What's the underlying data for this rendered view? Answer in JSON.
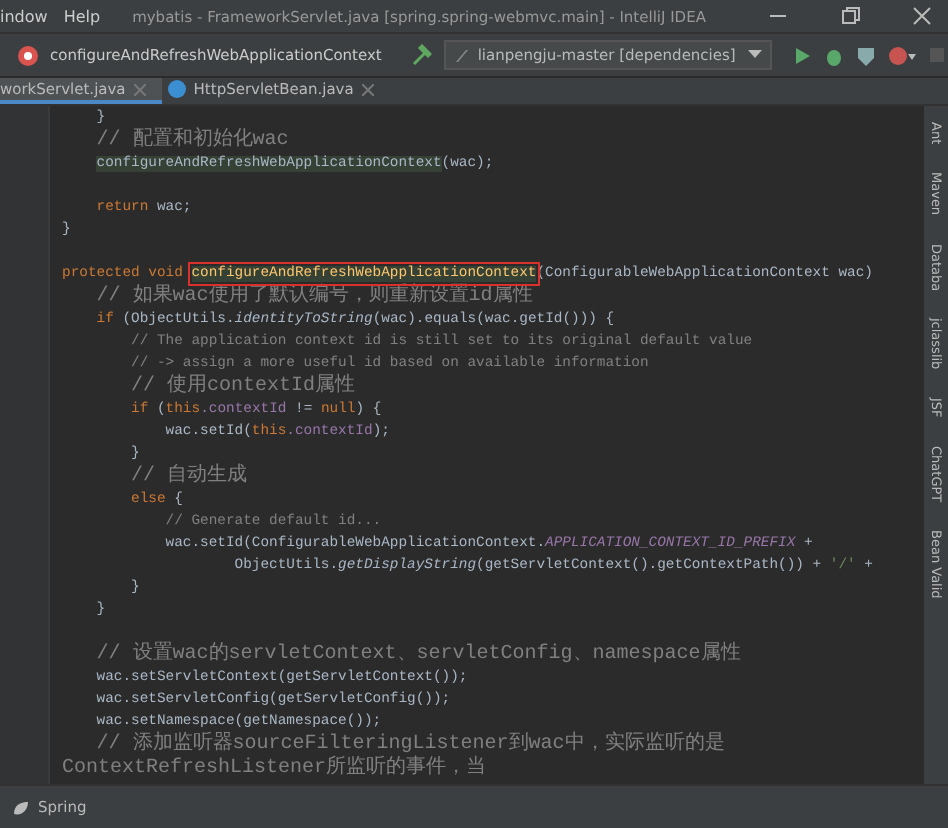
{
  "menu": {
    "items": [
      "indow",
      "Help"
    ],
    "title": "mybatis - FrameworkServlet.java [spring.spring-webmvc.main] - IntelliJ IDEA"
  },
  "toolbar": {
    "breadcrumb": "configureAndRefreshWebApplicationContext",
    "run_config": "lianpengju-master [dependencies]"
  },
  "tabs": [
    {
      "label": "workServlet.java",
      "selected": true
    },
    {
      "label": "HttpServletBean.java",
      "selected": false
    }
  ],
  "editor": {
    "lines": [
      {
        "kind": "code",
        "segments": [
          {
            "text": "    }",
            "kind": "plain"
          }
        ]
      },
      {
        "kind": "code",
        "segments": [
          {
            "text": "    // 配置和初始化wac",
            "kind": "comment"
          }
        ]
      },
      {
        "kind": "code",
        "segments": [
          {
            "text": "    configureAndRefreshWebApplicationContext",
            "kind": "usage"
          },
          {
            "text": "(wac);",
            "kind": "plain"
          }
        ]
      },
      {
        "kind": "blank"
      },
      {
        "kind": "code",
        "segments": [
          {
            "text": "    return ",
            "kind": "keyword"
          },
          {
            "text": "wac;",
            "kind": "plain"
          }
        ]
      },
      {
        "kind": "code",
        "segments": [
          {
            "text": "}",
            "kind": "plain"
          }
        ]
      },
      {
        "kind": "blank"
      },
      {
        "kind": "code",
        "segments": [
          {
            "text": "protected void ",
            "kind": "keyword"
          },
          {
            "text": "configureAndRefreshWebApplicationContext",
            "kind": "declaration",
            "boxed": true
          },
          {
            "text": "(ConfigurableWebApplicationContext wac)",
            "kind": "plain"
          }
        ]
      },
      {
        "kind": "code",
        "segments": [
          {
            "text": "    // 如果wac使用了默认编号，则重新设置id属性",
            "kind": "comment"
          }
        ]
      },
      {
        "kind": "code",
        "segments": [
          {
            "text": "    if ",
            "kind": "keyword"
          },
          {
            "text": "(ObjectUtils.",
            "kind": "plain"
          },
          {
            "text": "identityToString",
            "kind": "static"
          },
          {
            "text": "(wac).equals(wac.getId())) {",
            "kind": "plain"
          }
        ]
      },
      {
        "kind": "code",
        "segments": [
          {
            "text": "        // The application context id is still set to its original default value",
            "kind": "comment"
          }
        ]
      },
      {
        "kind": "code",
        "segments": [
          {
            "text": "        // -> assign a more useful id based on available information",
            "kind": "comment"
          }
        ]
      },
      {
        "kind": "code",
        "segments": [
          {
            "text": "        // 使用contextId属性",
            "kind": "comment"
          }
        ]
      },
      {
        "kind": "code",
        "segments": [
          {
            "text": "        if ",
            "kind": "keyword"
          },
          {
            "text": "(",
            "kind": "plain"
          },
          {
            "text": "this",
            "kind": "keyword"
          },
          {
            "text": ".contextId",
            "kind": "field"
          },
          {
            "text": " != ",
            "kind": "plain"
          },
          {
            "text": "null",
            "kind": "keyword"
          },
          {
            "text": ") {",
            "kind": "plain"
          }
        ]
      },
      {
        "kind": "code",
        "segments": [
          {
            "text": "            wac.setId(",
            "kind": "plain"
          },
          {
            "text": "this",
            "kind": "keyword"
          },
          {
            "text": ".contextId",
            "kind": "field"
          },
          {
            "text": ");",
            "kind": "plain"
          }
        ]
      },
      {
        "kind": "code",
        "segments": [
          {
            "text": "        }",
            "kind": "plain"
          }
        ]
      },
      {
        "kind": "code",
        "segments": [
          {
            "text": "        // 自动生成",
            "kind": "comment"
          }
        ]
      },
      {
        "kind": "code",
        "segments": [
          {
            "text": "        else ",
            "kind": "keyword"
          },
          {
            "text": "{",
            "kind": "plain"
          }
        ]
      },
      {
        "kind": "code",
        "segments": [
          {
            "text": "            // Generate default id...",
            "kind": "comment"
          }
        ]
      },
      {
        "kind": "code",
        "segments": [
          {
            "text": "            wac.setId(ConfigurableWebApplicationContext.",
            "kind": "plain"
          },
          {
            "text": "APPLICATION_CONTEXT_ID_PREFIX",
            "kind": "constant"
          },
          {
            "text": " +",
            "kind": "plain"
          }
        ]
      },
      {
        "kind": "code",
        "segments": [
          {
            "text": "                    ObjectUtils.",
            "kind": "plain"
          },
          {
            "text": "getDisplayString",
            "kind": "static"
          },
          {
            "text": "(getServletContext().getContextPath()) + ",
            "kind": "plain"
          },
          {
            "text": "'/'",
            "kind": "string"
          },
          {
            "text": " +",
            "kind": "plain"
          }
        ]
      },
      {
        "kind": "code",
        "segments": [
          {
            "text": "        }",
            "kind": "plain"
          }
        ]
      },
      {
        "kind": "code",
        "segments": [
          {
            "text": "    }",
            "kind": "plain"
          }
        ]
      },
      {
        "kind": "blank"
      },
      {
        "kind": "code",
        "segments": [
          {
            "text": "    // 设置wac的servletContext、servletConfig、namespace属性",
            "kind": "comment"
          }
        ]
      },
      {
        "kind": "code",
        "segments": [
          {
            "text": "    wac.setServletContext(getServletContext());",
            "kind": "plain"
          }
        ]
      },
      {
        "kind": "code",
        "segments": [
          {
            "text": "    wac.setServletConfig(getServletConfig());",
            "kind": "plain"
          }
        ]
      },
      {
        "kind": "code",
        "segments": [
          {
            "text": "    wac.setNamespace(getNamespace());",
            "kind": "plain"
          }
        ]
      },
      {
        "kind": "code",
        "segments": [
          {
            "text": "    // 添加监听器sourceFilteringListener到wac中，实际监听的是ContextRefreshListener所监听的事件，当",
            "kind": "comment"
          }
        ]
      }
    ]
  },
  "right_panel": {
    "labels": [
      "Ant",
      "Maven",
      "Databa",
      "jclasslib",
      "JSF",
      "ChatGPT",
      "Bean Valid"
    ]
  },
  "bottom_bar": {
    "tool": "Spring"
  }
}
